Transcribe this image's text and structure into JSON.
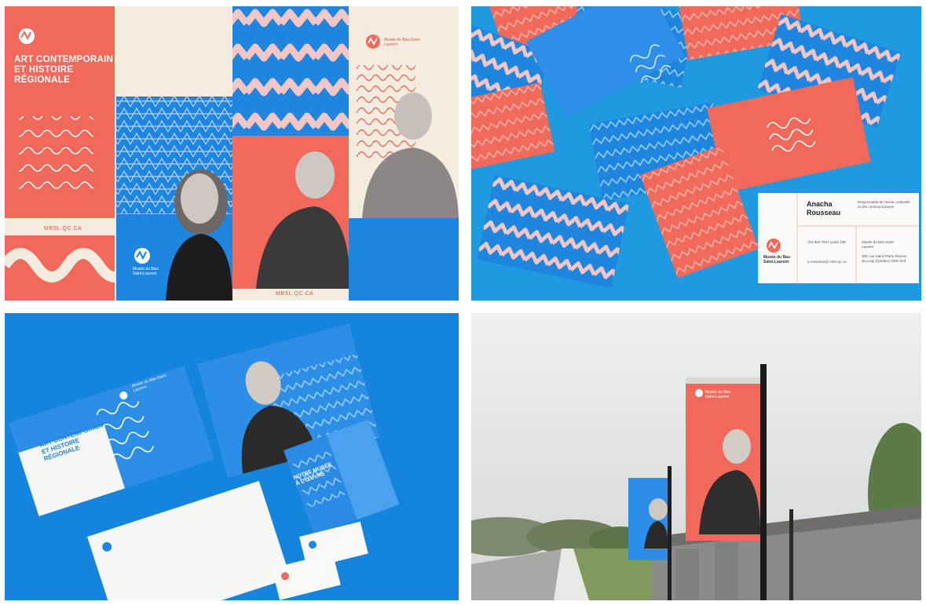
{
  "brand": {
    "colors": {
      "coral": "#f0695a",
      "blue": "#1f86e0",
      "pink": "#f4c6c6",
      "cream": "#f3ecdf"
    },
    "museum_name": "Musée du Bas-Saint-Laurent",
    "logo_icon": "squiggle-circle-logo-icon"
  },
  "tile_posters": {
    "headline": "ART CONTEMPORAIN ET HISTOIRE RÉGIONALE",
    "url_1": "MBSL.QC.CA",
    "url_2": "MBSL.QC.CA",
    "logo_label_1": "Musée du Bas-Saint-Laurent",
    "logo_label_2": "Musée du Bas-Saint-Laurent"
  },
  "tile_cards": {
    "person_first": "Anacha",
    "person_last": "Rousseau",
    "role": "Responsable de l'action culturelle et des communications",
    "phone": "418 862-7547 poste 108",
    "email": "a.rousseau@ mbsl.qc.ca",
    "org": "Musée du Bas-Saint-Laurent",
    "address": "300, rue Saint-Pierre Rivière-du-Loup (Québec) G5R 3V3",
    "logo_label": "Musée du Bas-Saint-Laurent"
  },
  "tile_stationery": {
    "folder_text": "ART CONTEMPORAIN ET HISTOIRE RÉGIONALE",
    "brochure_text": "NOTRE MUSÉE À L'ŒUVRE",
    "logo_label": "Musée du Bas-Saint-Laurent"
  },
  "tile_banners": {
    "banner_logo_label": "Musée du Bas-Saint-Laurent"
  }
}
